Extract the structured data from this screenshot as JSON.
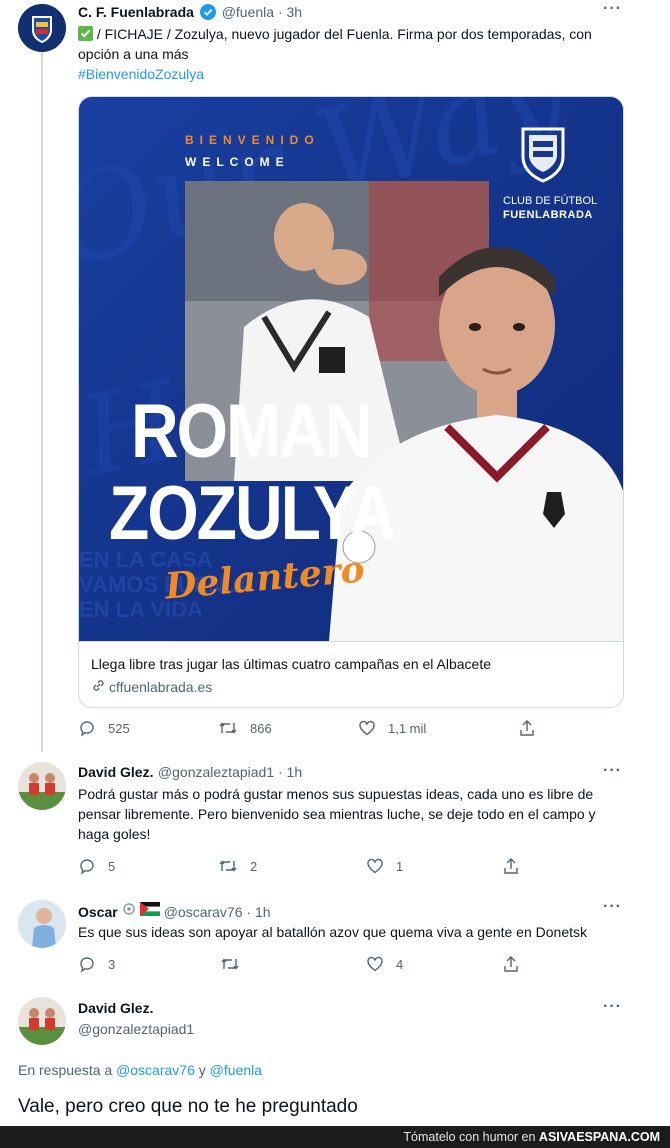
{
  "tweet1": {
    "name": "C. F. Fuenlabrada",
    "handle": "@fuenla · 3h",
    "text_main": "/ FICHAJE / Zozulya, nuevo jugador del Fuenla. Firma por dos temporadas, con opción a una más",
    "hashtag": "#BienvenidoZozulya",
    "card": {
      "bienvenido": "BIENVENIDO",
      "welcome": "WELCOME",
      "club_line1": "CLUB DE FÚTBOL",
      "club_line2": "FUENLABRADA",
      "first_name": "ROMAN",
      "last_name": "ZOZULYA",
      "position": "Delantero",
      "title": "Llega libre tras jugar las últimas cuatro campañas en el Albacete",
      "domain": "cffuenlabrada.es"
    },
    "replies": "525",
    "retweets": "866",
    "likes": "1,1 mil"
  },
  "tweet2": {
    "name": "David Glez.",
    "handle": "@gonzaleztapiad1 · 1h",
    "text": "Podrá gustar más o podrá gustar menos sus supuestas ideas, cada uno es libre de pensar libremente. Pero bienvenido sea mientras luche, se deje todo en el campo y haga goles!",
    "replies": "5",
    "retweets": "2",
    "likes": "1"
  },
  "tweet3": {
    "name": "Oscar",
    "handle": "@oscarav76 · 1h",
    "text": "Es que sus ideas son apoyar al batallón azov que quema viva a gente en Donetsk",
    "replies": "3",
    "retweets": "",
    "likes": "4"
  },
  "tweet4": {
    "name": "David Glez.",
    "handle": "@gonzaleztapiad1",
    "reply_prefix": "En respuesta a",
    "reply_user1": "@oscarav76",
    "reply_and": "y",
    "reply_user2": "@fuenla",
    "text": "Vale, pero creo que no te he preguntado"
  },
  "more_label": "···",
  "footer": {
    "prefix": "Tómatelo con humor en",
    "site": "ASIVAESPANA.COM"
  },
  "colors": {
    "link": "#1d9bf0",
    "card_blue": "#16378e",
    "accent_orange": "#f08a24"
  }
}
